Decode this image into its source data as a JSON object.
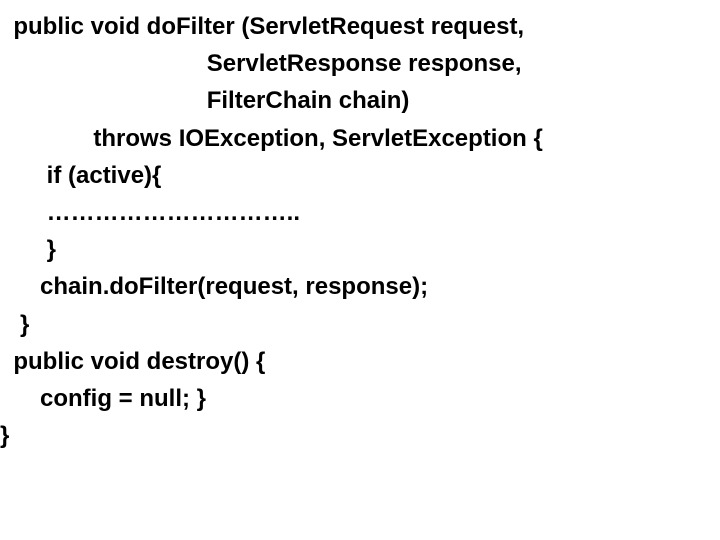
{
  "code": {
    "l1": "  public void doFilter (ServletRequest request,",
    "l2": "                               ServletResponse response,",
    "l3": "                               FilterChain chain)",
    "l4": "              throws IOException, ServletException {",
    "l5": "       if (active){",
    "l6": "       …………………………..",
    "l7": "       }",
    "l8": "      chain.doFilter(request, response);",
    "l9": "   }",
    "l10": "  public void destroy() {",
    "l11": "      config = null; }",
    "l12": "}"
  }
}
